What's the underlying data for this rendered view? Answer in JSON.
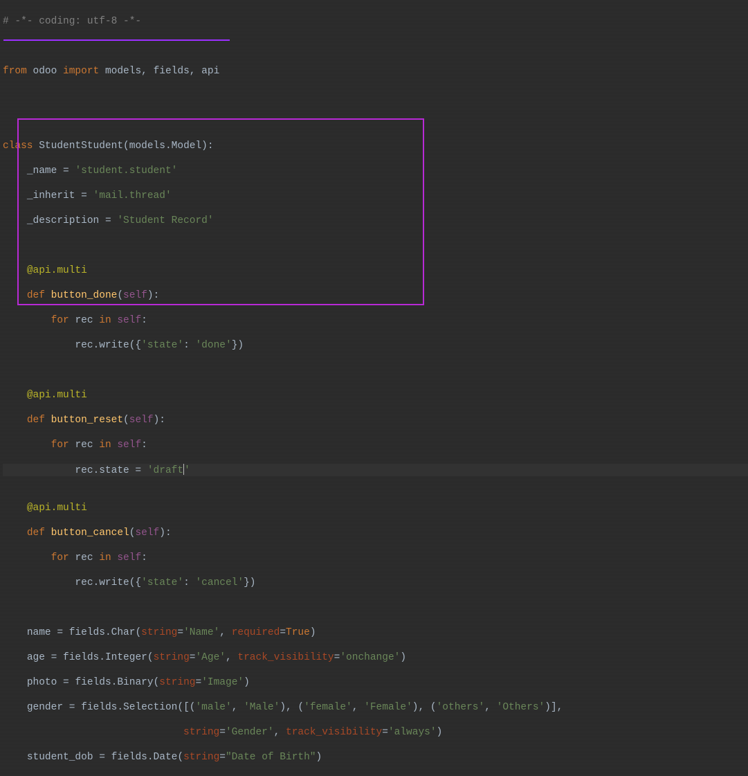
{
  "code": {
    "l1": {
      "comment": "# -*- coding: utf-8 -*-"
    },
    "l3": {
      "from": "from",
      "mod1": "odoo",
      "import": "import",
      "mods": "models, fields, api"
    },
    "l6": {
      "class": "class",
      "name": "StudentStudent",
      "base": "models.Model",
      "colon": "):"
    },
    "l7": {
      "attr": "_name",
      "val": "'student.student'"
    },
    "l8": {
      "attr": "_inherit",
      "val": "'mail.thread'"
    },
    "l9": {
      "attr": "_description",
      "val": "'Student Record'"
    },
    "dec": "@api.multi",
    "def": "def",
    "self": "self",
    "for": "for",
    "rec": "rec",
    "in": "in",
    "m1": {
      "fn": "button_done",
      "write": "rec.write({",
      "key": "'state'",
      "val": "'done'",
      "end": "})"
    },
    "m2": {
      "fn": "button_reset",
      "assign": "rec.state = ",
      "val": "'draft",
      "close": "'"
    },
    "m3": {
      "fn": "button_cancel",
      "write": "rec.write({",
      "key": "'state'",
      "val": "'cancel'",
      "end": "})"
    },
    "f1": {
      "name": "name",
      "call": "fields.Char(",
      "p1": "string",
      "v1": "'Name'",
      "p2": "required",
      "v2": "True",
      "end": ")"
    },
    "f2": {
      "name": "age",
      "call": "fields.Integer(",
      "p1": "string",
      "v1": "'Age'",
      "p2": "track_visibility",
      "v2": "'onchange'",
      "end": ")"
    },
    "f3": {
      "name": "photo",
      "call": "fields.Binary(",
      "p1": "string",
      "v1": "'Image'",
      "end": ")"
    },
    "f4": {
      "name": "gender",
      "call": "fields.Selection([(",
      "m1": "'male'",
      "M1": "'Male'",
      "m2": "'female'",
      "M2": "'Female'",
      "m3": "'others'",
      "M3": "'Others'",
      "end1": ")],"
    },
    "f4b": {
      "p1": "string",
      "v1": "'Gender'",
      "p2": "track_visibility",
      "v2": "'always'",
      "end": ")"
    },
    "f5": {
      "name": "student_dob",
      "call": "fields.Date(",
      "p1": "string",
      "v1": "\"Date of Birth\"",
      "end": ")"
    }
  }
}
